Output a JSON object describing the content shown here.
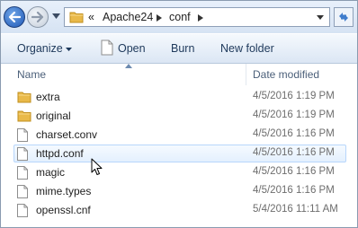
{
  "address": {
    "overflow_chevron": "«",
    "crumbs": [
      "Apache24",
      "conf"
    ],
    "separator": "▶"
  },
  "toolbar": {
    "organize_label": "Organize",
    "open_label": "Open",
    "burn_label": "Burn",
    "new_folder_label": "New folder"
  },
  "columns": {
    "name": "Name",
    "date_modified": "Date modified"
  },
  "files": [
    {
      "name": "extra",
      "date": "4/5/2016 1:19 PM",
      "type": "folder"
    },
    {
      "name": "original",
      "date": "4/5/2016 1:19 PM",
      "type": "folder"
    },
    {
      "name": "charset.conv",
      "date": "4/5/2016 1:16 PM",
      "type": "file"
    },
    {
      "name": "httpd.conf",
      "date": "4/5/2016 1:16 PM",
      "type": "file",
      "state": "hover"
    },
    {
      "name": "magic",
      "date": "4/5/2016 1:16 PM",
      "type": "file"
    },
    {
      "name": "mime.types",
      "date": "4/5/2016 1:16 PM",
      "type": "file"
    },
    {
      "name": "openssl.cnf",
      "date": "5/4/2016 11:11 AM",
      "type": "file"
    }
  ],
  "colors": {
    "folder": "#e9b949",
    "hover_border": "#b8d6fb",
    "hover_fill": "#e4f0fe",
    "toolbar_text": "#1e395b"
  },
  "icons": {
    "back": "back-arrow-icon",
    "forward": "forward-arrow-icon",
    "history": "history-dropdown-icon",
    "address_folder": "folder-icon",
    "refresh": "refresh-icon",
    "folder": "folder-icon",
    "file": "document-icon",
    "cursor": "mouse-cursor-icon"
  }
}
